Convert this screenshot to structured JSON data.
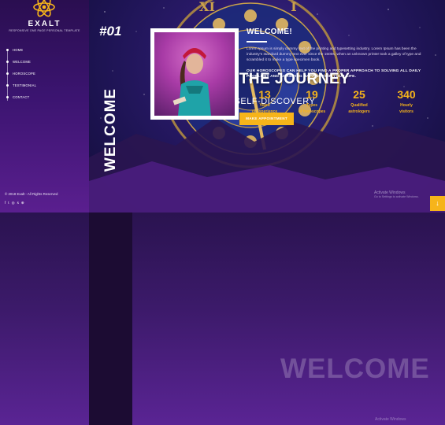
{
  "brand": {
    "name": "EXALT",
    "tagline": "RESPONSIVE ONE PAGE PERSONAL TEMPLATE"
  },
  "nav": {
    "items": [
      {
        "label": "HOME"
      },
      {
        "label": "WELCOME"
      },
      {
        "label": "HOROSCOPE"
      },
      {
        "label": "TESTIMONIAL"
      },
      {
        "label": "CONTACT"
      }
    ]
  },
  "footer": {
    "copyright": "© 2018 Exalt - All Rights Reserved"
  },
  "socials": [
    "facebook-icon",
    "twitter-icon",
    "instagram-icon",
    "skype-icon",
    "dribbble-icon"
  ],
  "hero": {
    "title": "START THE JOURNEY",
    "subtitle": "OF SELF-DISCOVERY",
    "button": "MAKE APPOINTMENT",
    "watermark_title": "Activate Windows",
    "watermark_sub": "Go to Settings to activate Windows."
  },
  "welcome": {
    "number": "#01",
    "vertical_label": "WELCOME",
    "title": "WELCOME!",
    "text": "Lorem Ipsum is simply dummy text of the printing and typesetting industry. Lorem Ipsum has been the industry's standard dummy text ever since the 1500s, when an unknown printer took a galley of type and scrambled it to make a type specimen book.",
    "highlight": "OUR HOROSCOPES CAN HELP YOU FIND A PROPER APPROACH TO SOLVING ALL DAILY PROBLEMS AND ACHIEVING HAPPINESS IN YOUR LIFE.",
    "stats": [
      {
        "value": "13",
        "label1": "Years",
        "label2": "of experience"
      },
      {
        "value": "19",
        "label1": "Types",
        "label2": "of horoscopes"
      },
      {
        "value": "25",
        "label1": "Qualified",
        "label2": "astrologers"
      },
      {
        "value": "340",
        "label1": "Hourly",
        "label2": "visitors"
      }
    ],
    "background_word": "WELCOME",
    "watermark_title": "Activate Windows"
  },
  "colors": {
    "accent": "#f6b41a",
    "sidebar": "#2a0e50",
    "dark_column": "#1c0c33"
  }
}
